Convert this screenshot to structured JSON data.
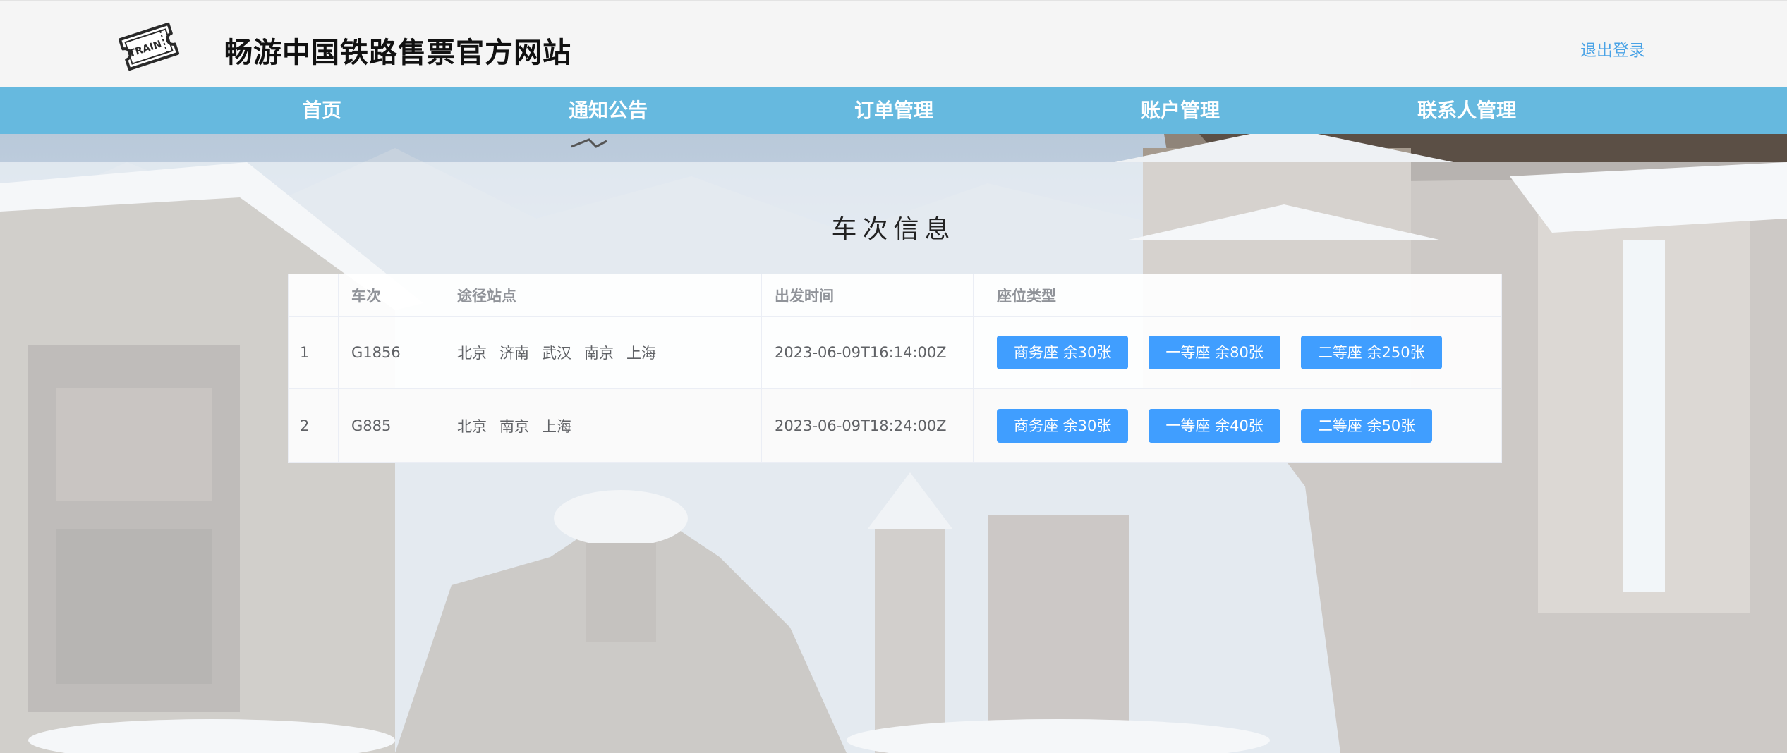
{
  "header": {
    "site_title": "畅游中国铁路售票官方网站",
    "logout_label": "退出登录",
    "logo_text": "TRAIN"
  },
  "nav": {
    "items": [
      {
        "label": "首页"
      },
      {
        "label": "通知公告"
      },
      {
        "label": "订单管理"
      },
      {
        "label": "账户管理"
      },
      {
        "label": "联系人管理"
      }
    ]
  },
  "main": {
    "section_title": "车次信息",
    "table": {
      "columns": [
        "",
        "车次",
        "途径站点",
        "出发时间",
        "座位类型"
      ],
      "rows": [
        {
          "index": "1",
          "train_no": "G1856",
          "stations": [
            "北京",
            "济南",
            "武汉",
            "南京",
            "上海"
          ],
          "departure": "2023-06-09T16:14:00Z",
          "seats": [
            "商务座 余30张",
            "一等座 余80张",
            "二等座 余250张"
          ]
        },
        {
          "index": "2",
          "train_no": "G885",
          "stations": [
            "北京",
            "南京",
            "上海"
          ],
          "departure": "2023-06-09T18:24:00Z",
          "seats": [
            "商务座 余30张",
            "一等座 余40张",
            "二等座 余50张"
          ]
        }
      ]
    }
  },
  "colors": {
    "nav_bg": "#66b9df",
    "button_primary": "#409eff",
    "link": "#4aa3e6"
  },
  "icons": {
    "logo": "train-ticket-icon"
  }
}
